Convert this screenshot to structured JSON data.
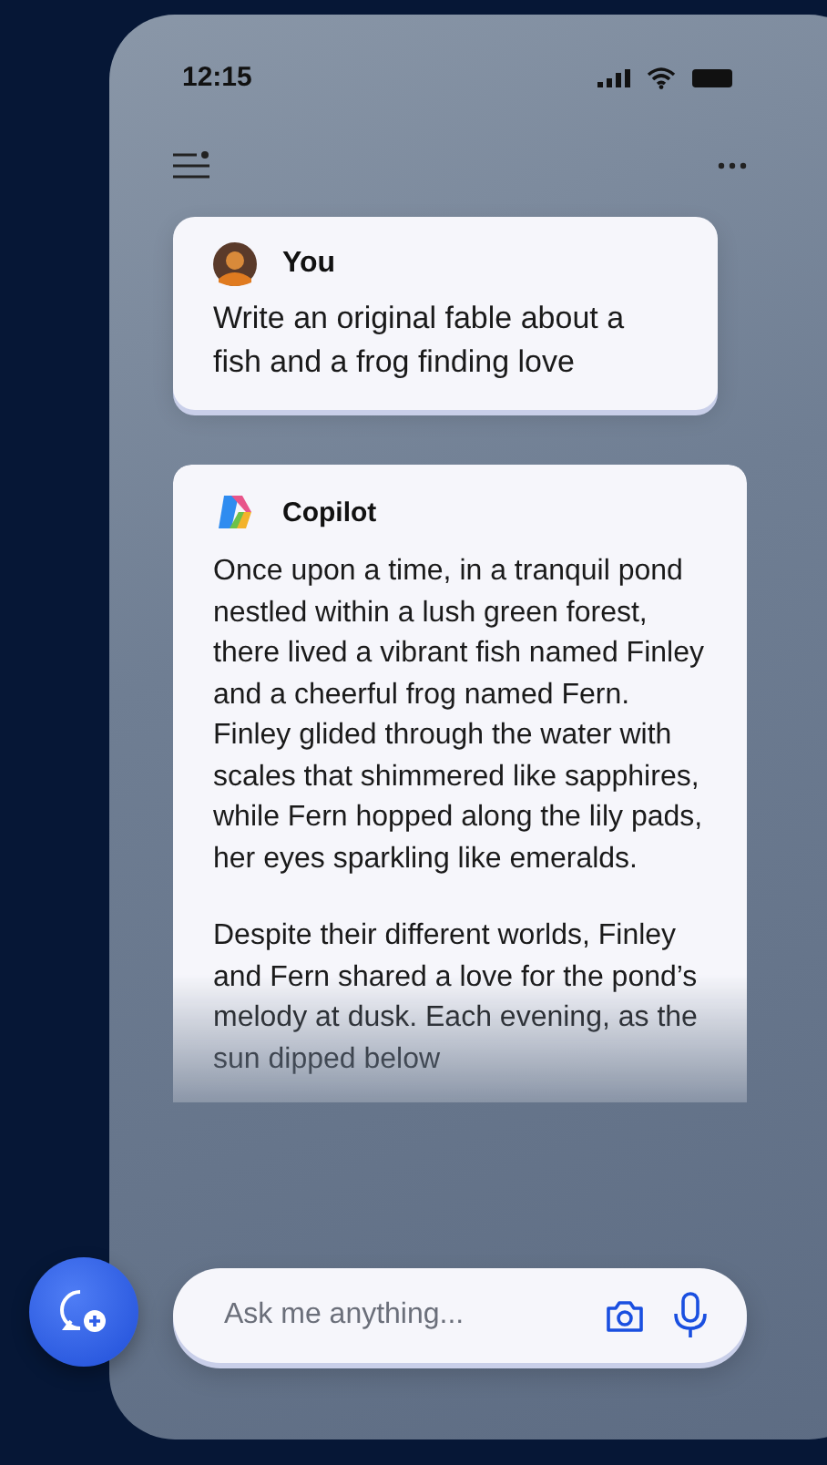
{
  "status_bar": {
    "time": "12:15"
  },
  "messages": [
    {
      "kind": "user",
      "author": "You",
      "paragraphs": [
        "Write an original fable about a fish and a frog finding love"
      ]
    },
    {
      "kind": "assistant",
      "author": "Copilot",
      "paragraphs": [
        "Once upon a time, in a tranquil pond nestled within a lush green forest, there lived a vibrant fish named Finley and a cheerful frog named Fern. Finley glided through the water with scales that shimmered like sapphires, while Fern hopped along the lily pads, her eyes sparkling like emeralds.",
        "Despite their different worlds, Finley and Fern shared a love for the pond’s melody at dusk. Each evening, as the sun dipped below"
      ]
    }
  ],
  "composer": {
    "placeholder": "Ask me anything..."
  }
}
